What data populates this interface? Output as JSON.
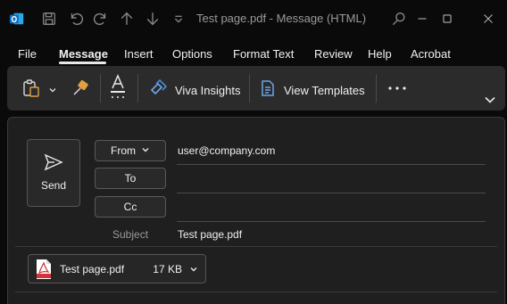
{
  "titlebar": {
    "title": "Test page.pdf  -  Message (HTML)",
    "icons": [
      "outlook-app-icon",
      "save-icon",
      "undo-icon",
      "redo-icon",
      "up-arrow-icon",
      "down-arrow-icon",
      "customize-qat-icon",
      "search-icon",
      "minimize-icon",
      "maximize-icon",
      "close-icon"
    ]
  },
  "menu": {
    "items": [
      "File",
      "Message",
      "Insert",
      "Options",
      "Format Text",
      "Review",
      "Help",
      "Acrobat"
    ],
    "active": "Message"
  },
  "ribbon": {
    "viva_insights_label": "Viva Insights",
    "view_templates_label": "View Templates"
  },
  "compose": {
    "send_label": "Send",
    "from_label": "From",
    "from_value": "user@company.com",
    "to_label": "To",
    "cc_label": "Cc",
    "subject_label": "Subject",
    "subject_value": "Test page.pdf",
    "attachment": {
      "name": "Test page.pdf",
      "size": "17 KB"
    }
  },
  "colors": {
    "background": "#0a0a0a",
    "ribbon": "#2b2b2b",
    "compose": "#1f1f1f",
    "outlook_blue": "#0f6cbd",
    "pdf_red": "#d13438"
  }
}
